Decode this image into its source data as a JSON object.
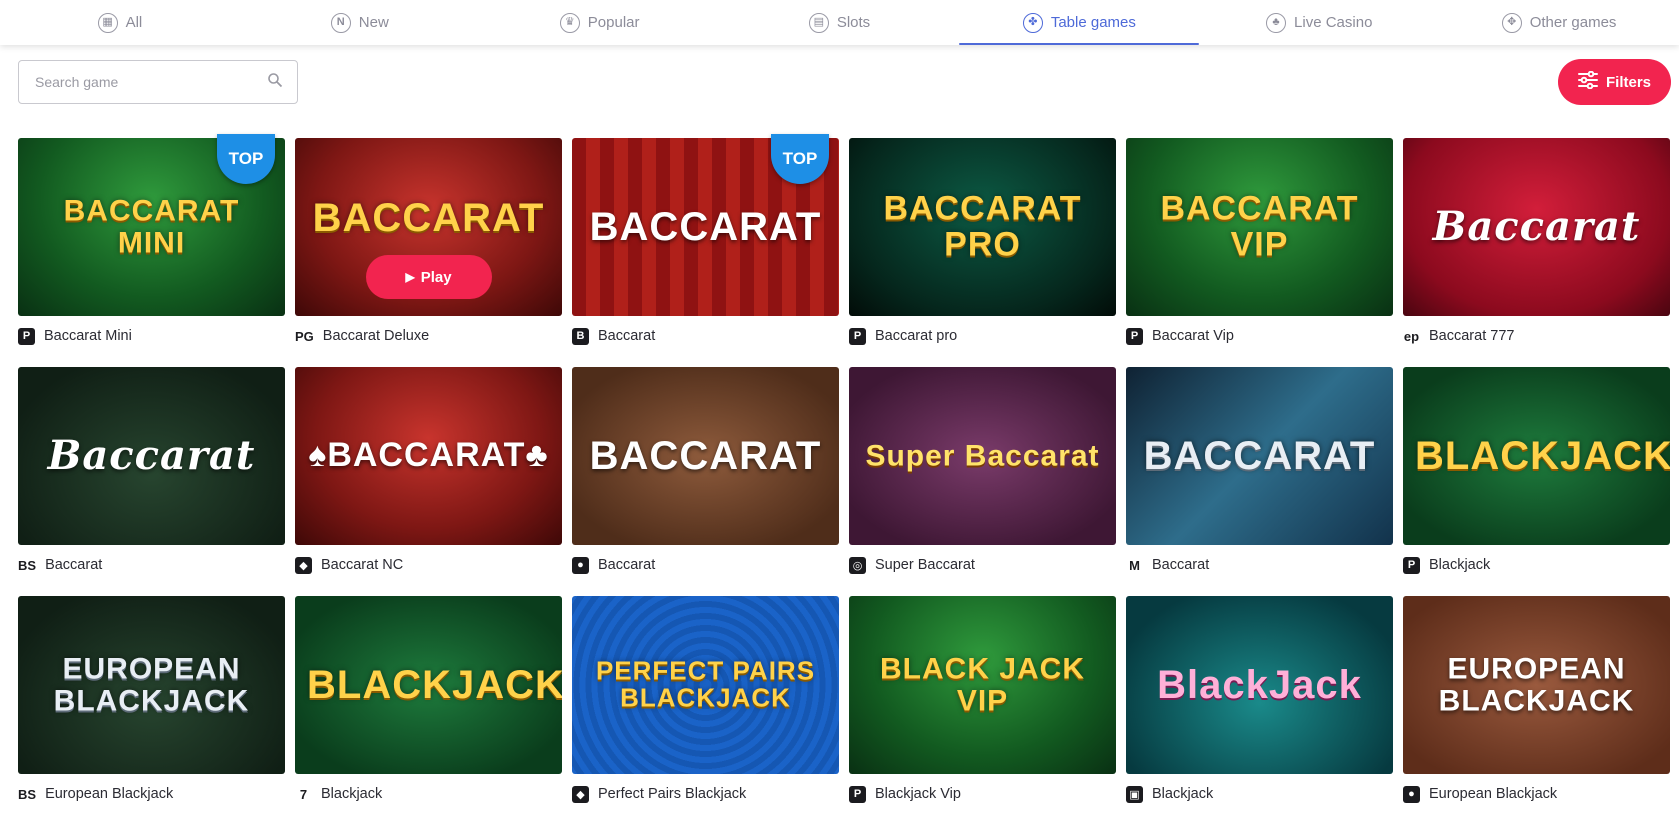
{
  "tabs": [
    {
      "label": "All",
      "icon": "grid-icon",
      "glyph": "▦",
      "active": false
    },
    {
      "label": "New",
      "icon": "new-icon",
      "glyph": "N",
      "active": false
    },
    {
      "label": "Popular",
      "icon": "popular-icon",
      "glyph": "♛",
      "active": false
    },
    {
      "label": "Slots",
      "icon": "slots-icon",
      "glyph": "▤",
      "active": false
    },
    {
      "label": "Table games",
      "icon": "table-games-icon",
      "glyph": "✤",
      "active": true
    },
    {
      "label": "Live Casino",
      "icon": "live-casino-icon",
      "glyph": "♣",
      "active": false
    },
    {
      "label": "Other games",
      "icon": "other-games-icon",
      "glyph": "✥",
      "active": false
    }
  ],
  "search": {
    "placeholder": "Search game",
    "value": ""
  },
  "filters_label": "Filters",
  "top_badge_label": "TOP",
  "play_label": "Play",
  "games": [
    {
      "name": "Baccarat Mini",
      "provider": "P",
      "thumb_text": "BACCARAT MINI",
      "theme": "green",
      "style": "gold",
      "top": true
    },
    {
      "name": "Baccarat Deluxe",
      "provider": "PG",
      "thumb_text": "BACCARAT",
      "theme": "red",
      "style": "gold",
      "hover": true
    },
    {
      "name": "Baccarat",
      "provider": "B",
      "thumb_text": "BACCARAT",
      "theme": "curtain",
      "style": "white",
      "top": true
    },
    {
      "name": "Baccarat pro",
      "provider": "P",
      "thumb_text": "BACCARAT PRO",
      "theme": "dark",
      "style": "gold"
    },
    {
      "name": "Baccarat Vip",
      "provider": "P",
      "thumb_text": "BACCARAT VIP",
      "theme": "green",
      "style": "gold"
    },
    {
      "name": "Baccarat 777",
      "provider": "ep",
      "thumb_text": "Baccarat",
      "theme": "crimson",
      "style": "white"
    },
    {
      "name": "Baccarat",
      "provider": "BS",
      "thumb_text": "Baccarat",
      "theme": "felt",
      "style": "white"
    },
    {
      "name": "Baccarat NC",
      "provider": "◆",
      "thumb_text": "♠BACCARAT♣",
      "theme": "red",
      "style": "white"
    },
    {
      "name": "Baccarat",
      "provider": "●",
      "thumb_text": "BACCARAT",
      "theme": "brown",
      "style": "white"
    },
    {
      "name": "Super Baccarat",
      "provider": "◎",
      "thumb_text": "Super Baccarat",
      "theme": "purple",
      "style": "yellowt"
    },
    {
      "name": "Baccarat",
      "provider": "M",
      "thumb_text": "BACCARAT",
      "theme": "steel",
      "style": "silver"
    },
    {
      "name": "Blackjack",
      "provider": "P",
      "thumb_text": "BLACKJACK",
      "theme": "bjgreen",
      "style": "gold"
    },
    {
      "name": "European Blackjack",
      "provider": "BS",
      "thumb_text": "EUROPEAN BLACKJACK",
      "theme": "felt",
      "style": "silver"
    },
    {
      "name": "Blackjack",
      "provider": "7",
      "thumb_text": "BLACKJACK",
      "theme": "bjgreen",
      "style": "gold"
    },
    {
      "name": "Perfect Pairs Blackjack",
      "provider": "◆",
      "thumb_text": "PERFECT PAIRS BLACKJACK",
      "theme": "blue",
      "style": "gold"
    },
    {
      "name": "Blackjack Vip",
      "provider": "P",
      "thumb_text": "BLACK JACK VIP",
      "theme": "green",
      "style": "gold"
    },
    {
      "name": "Blackjack",
      "provider": "▣",
      "thumb_text": "BlackJack",
      "theme": "teal",
      "style": "pinkt"
    },
    {
      "name": "European Blackjack",
      "provider": "●",
      "thumb_text": "EUROPEAN BLACKJACK",
      "theme": "tan",
      "style": "white"
    }
  ],
  "colors": {
    "accent": "#4e6ad8",
    "cta": "#f2244f",
    "badge": "#1e8fe6"
  }
}
